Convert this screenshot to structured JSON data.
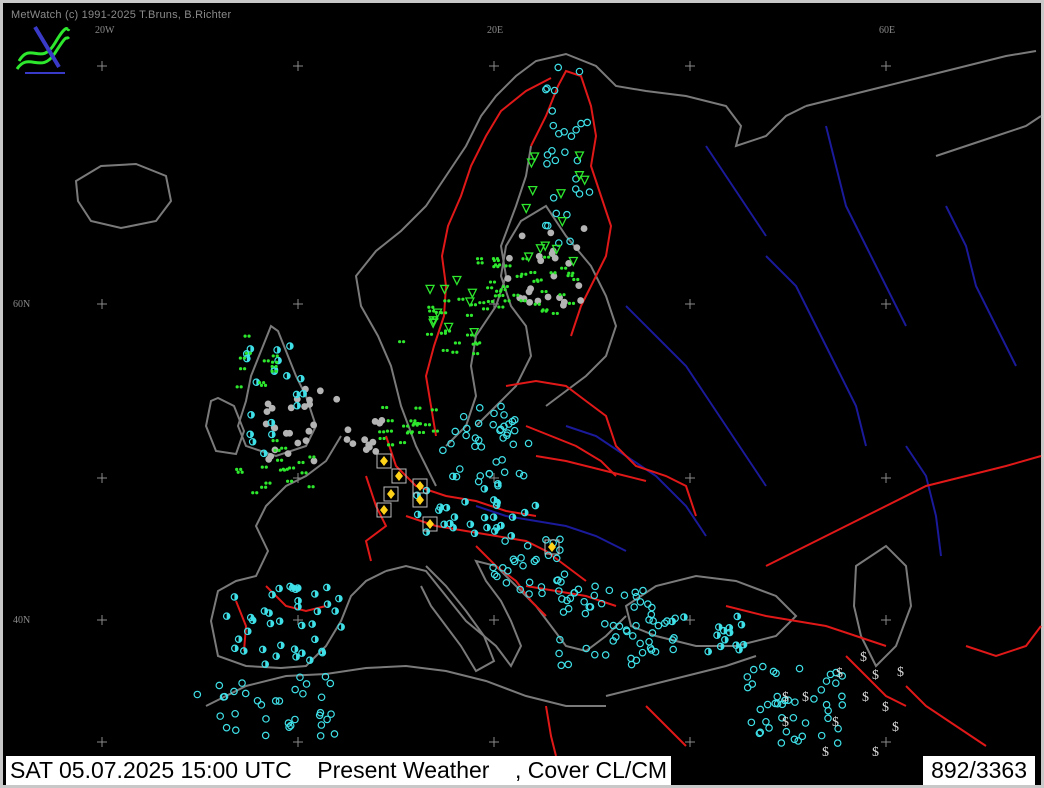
{
  "app": {
    "copyright": "MetWatch  (c) 1991-2025 T.Bruns, B.Richter"
  },
  "grid_labels": {
    "lon_20w": "20W",
    "lon_20e": "20E",
    "lon_60e": "60E",
    "lat_60n": "60N",
    "lat_40n": "40N"
  },
  "status": {
    "day": "SAT",
    "date": "05.07.2025",
    "time": "15:00 UTC",
    "product": "Present Weather",
    "overlay": ", Cover CL/CM",
    "left_text": "SAT 05.07.2025 15:00 UTC    Present Weather    , Cover CL/CM",
    "station_count": "892/3363"
  },
  "colors": {
    "coastline": "#7a7a7a",
    "borders": "#e01818",
    "rivers": "#1a1a9a",
    "cloud_symbol": "#3fe0e8",
    "rain_symbol": "#2ee82e",
    "thunder_symbol": "#ffd21a",
    "fog_symbol": "#b4b4b4",
    "dust_symbol": "#d8d8d8"
  },
  "icons": {
    "logo": "metwatch-logo-icon",
    "grid_cross": "plus-icon"
  }
}
